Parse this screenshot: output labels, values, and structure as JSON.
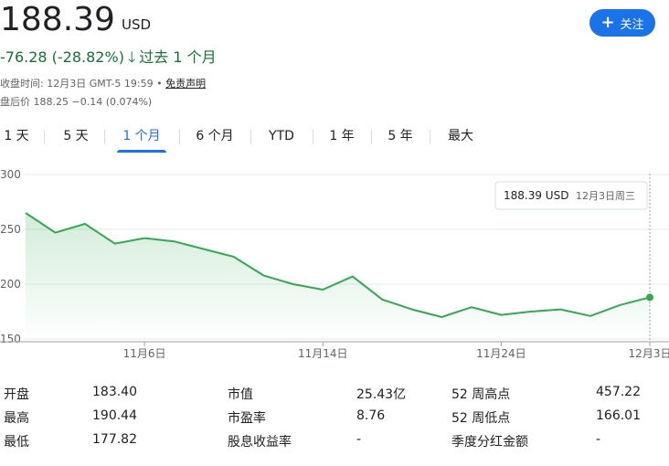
{
  "quote": {
    "price": "188.39",
    "currency": "USD",
    "change": "-76.28 (-28.82%)",
    "period": "过去 1 个月",
    "close_time": "收盘时间: 12月3日 GMT-5 19:59 •",
    "disclaimer_link": "免责声明",
    "after_hours": "盘后价 188.25 −0.14 (0.074%)"
  },
  "follow_button": {
    "label": "关注",
    "color": "#1a73e8"
  },
  "tabs": [
    "1 天",
    "5 天",
    "1 个月",
    "6 个月",
    "YTD",
    "1 年",
    "5 年",
    "最大"
  ],
  "active_tab": "1 个月",
  "tooltip": {
    "price": "188.39 USD",
    "date": "12月3日周三"
  },
  "chart_data": {
    "type": "area",
    "line_color": "#34a853",
    "y_ticks": [
      "300",
      "250",
      "200",
      "150"
    ],
    "ylim": [
      150,
      300
    ],
    "x_tick_labels": [
      "11月6日",
      "11月14日",
      "11月24日",
      "12月3日"
    ],
    "x_tick_index": [
      4,
      10,
      16,
      21
    ],
    "values": [
      265,
      247,
      255,
      237,
      242,
      239,
      232,
      225,
      208,
      200,
      195,
      207,
      186,
      177,
      170,
      179,
      172,
      175,
      177,
      171,
      181,
      188
    ]
  },
  "stats": {
    "col1": [
      {
        "label": "开盘",
        "value": "183.40"
      },
      {
        "label": "最高",
        "value": "190.44"
      },
      {
        "label": "最低",
        "value": "177.82"
      }
    ],
    "col2": [
      {
        "label": "市值",
        "value": "25.43亿"
      },
      {
        "label": "市盈率",
        "value": "8.76"
      },
      {
        "label": "股息收益率",
        "value": "-"
      }
    ],
    "col3": [
      {
        "label": "52 周高点",
        "value": "457.22"
      },
      {
        "label": "52 周低点",
        "value": "166.01"
      },
      {
        "label": "季度分红金额",
        "value": "-"
      }
    ]
  }
}
